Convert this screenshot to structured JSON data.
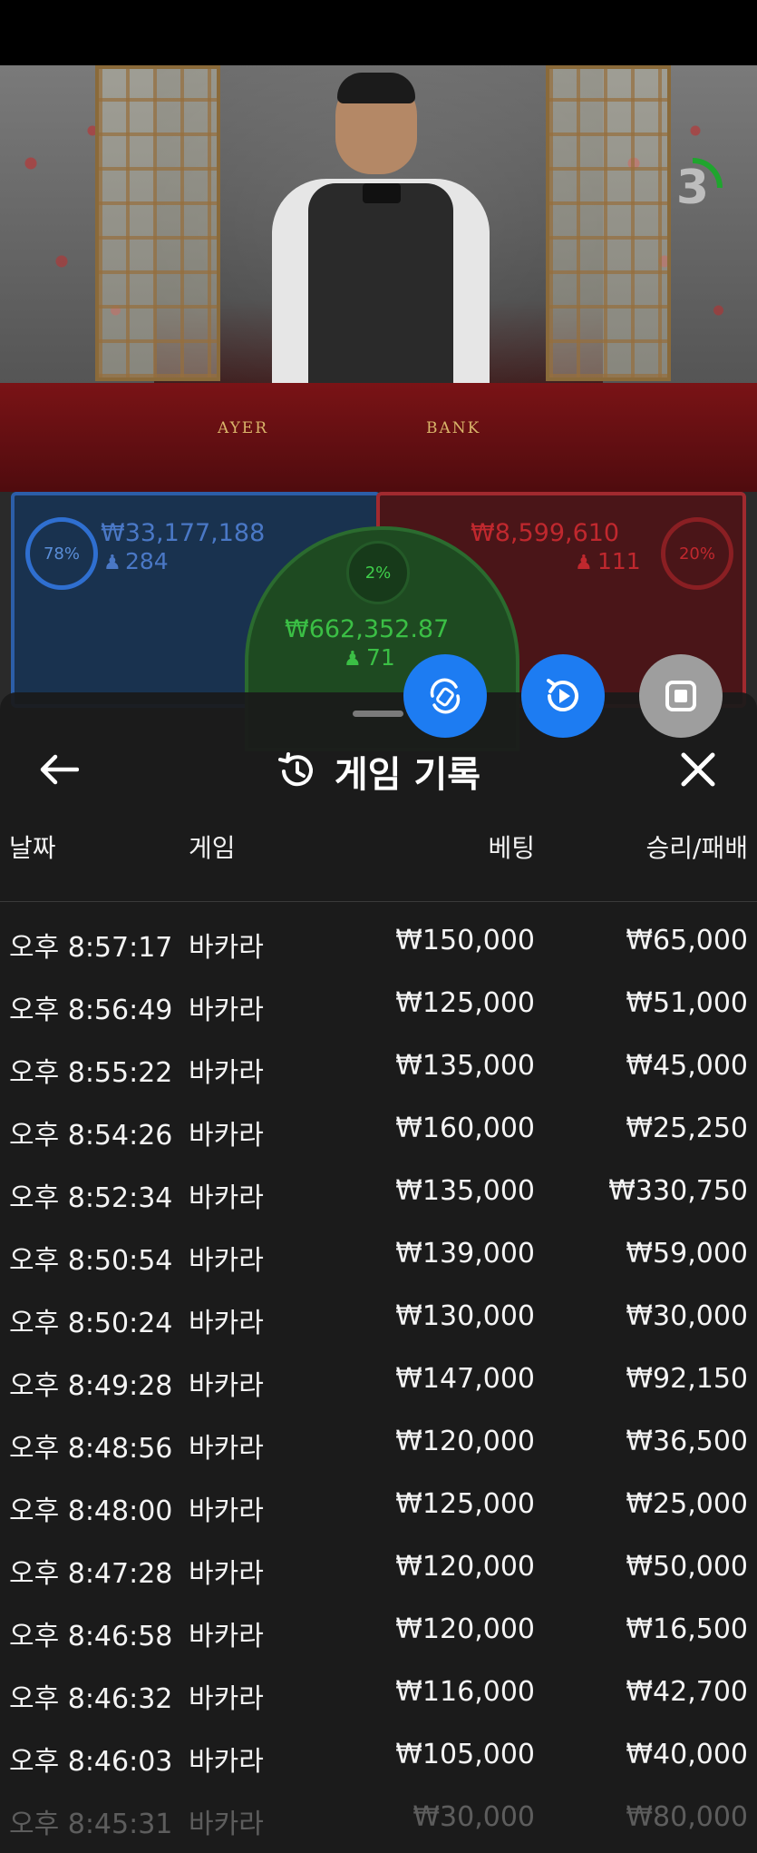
{
  "timer": {
    "value": "3"
  },
  "table_labels": {
    "player": "AYER",
    "banker": "BANK"
  },
  "player": {
    "percent": "78%",
    "amount": "₩33,177,188",
    "count": "284"
  },
  "banker": {
    "percent": "20%",
    "amount": "₩8,599,610",
    "count": "111"
  },
  "tie": {
    "percent": "2%",
    "amount": "₩662,352.87",
    "count": "71"
  },
  "buttons": {
    "rotate": "rotate-icon",
    "replay": "replay-icon",
    "stop": "stop-icon"
  },
  "panel": {
    "title": "게임 기록",
    "columns": {
      "date": "날짜",
      "game": "게임",
      "bet": "베팅",
      "result": "승리/패배"
    },
    "rows": [
      {
        "date": "오후 8:57:17",
        "game": "바카라",
        "bet": "₩150,000",
        "result": "₩65,000"
      },
      {
        "date": "오후 8:56:49",
        "game": "바카라",
        "bet": "₩125,000",
        "result": "₩51,000"
      },
      {
        "date": "오후 8:55:22",
        "game": "바카라",
        "bet": "₩135,000",
        "result": "₩45,000"
      },
      {
        "date": "오후 8:54:26",
        "game": "바카라",
        "bet": "₩160,000",
        "result": "₩25,250"
      },
      {
        "date": "오후 8:52:34",
        "game": "바카라",
        "bet": "₩135,000",
        "result": "₩330,750"
      },
      {
        "date": "오후 8:50:54",
        "game": "바카라",
        "bet": "₩139,000",
        "result": "₩59,000"
      },
      {
        "date": "오후 8:50:24",
        "game": "바카라",
        "bet": "₩130,000",
        "result": "₩30,000"
      },
      {
        "date": "오후 8:49:28",
        "game": "바카라",
        "bet": "₩147,000",
        "result": "₩92,150"
      },
      {
        "date": "오후 8:48:56",
        "game": "바카라",
        "bet": "₩120,000",
        "result": "₩36,500"
      },
      {
        "date": "오후 8:48:00",
        "game": "바카라",
        "bet": "₩125,000",
        "result": "₩25,000"
      },
      {
        "date": "오후 8:47:28",
        "game": "바카라",
        "bet": "₩120,000",
        "result": "₩50,000"
      },
      {
        "date": "오후 8:46:58",
        "game": "바카라",
        "bet": "₩120,000",
        "result": "₩16,500"
      },
      {
        "date": "오후 8:46:32",
        "game": "바카라",
        "bet": "₩116,000",
        "result": "₩42,700"
      },
      {
        "date": "오후 8:46:03",
        "game": "바카라",
        "bet": "₩105,000",
        "result": "₩40,000"
      },
      {
        "date": "오후 8:45:31",
        "game": "바카라",
        "bet": "₩30,000",
        "result": "₩80,000"
      }
    ]
  }
}
